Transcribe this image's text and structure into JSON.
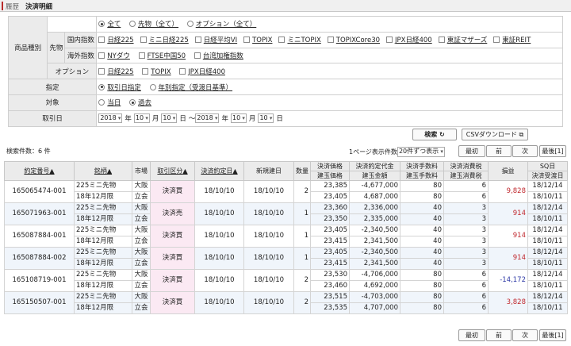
{
  "header": {
    "breadcrumb": "履歴",
    "title": "決済明細"
  },
  "conditions": {
    "product_label": "商品種別",
    "futures_label": "先物",
    "domestic_label": "国内指数",
    "overseas_label": "海外指数",
    "option_label": "オプション",
    "designation_label": "指定",
    "target_label": "対象",
    "date_label": "取引日",
    "product_options": [
      "全て",
      "先物（全て）",
      "オプション（全て）"
    ],
    "domestic_items": [
      "日経225",
      "ミニ日経225",
      "日経平均VI",
      "TOPIX",
      "ミニTOPIX",
      "TOPIXCore30",
      "JPX日経400",
      "東証マザーズ",
      "東証REIT"
    ],
    "overseas_items": [
      "NYダウ",
      "FTSE中国50",
      "台湾加権指数"
    ],
    "option_items": [
      "日経225",
      "TOPIX",
      "JPX日経400"
    ],
    "designation_options": [
      "取引日指定",
      "年別指定（受渡日基準）"
    ],
    "target_options": [
      "当日",
      "過去"
    ],
    "date_from": {
      "year": "2018",
      "month": "10",
      "day": "10"
    },
    "date_to": {
      "year": "2018",
      "month": "10",
      "day": "10"
    },
    "unit_year": "年",
    "unit_month": "月",
    "unit_day": "日",
    "range_sep": "～"
  },
  "buttons": {
    "search": "検索",
    "search_icon": "↻",
    "csv": "CSVダウンロード",
    "csv_icon": "⧉"
  },
  "result_count": "検索件数：6 件",
  "per_page_label": "1ページ表示件数",
  "per_page_value": "20件ずつ表示",
  "pagination": {
    "first": "最初",
    "prev": "前",
    "next": "次",
    "last": "最後[1]"
  },
  "table": {
    "headers": {
      "order_no": "約定番号",
      "order_no_sort": "▲",
      "issue": "銘柄",
      "issue_sort": "▲",
      "market": "市場",
      "kind": "取引区分",
      "kind_sort": "▲",
      "exec_date": "決済約定日",
      "exec_date_sort": "▲",
      "new_date": "新規建日",
      "qty": "数量",
      "settle_price": "決済価格",
      "open_price": "建玉価格",
      "settle_amount": "決済約定代金",
      "open_amount": "建玉金額",
      "settle_fee": "決済手数料",
      "open_fee": "建玉手数料",
      "settle_tax": "決済消費税",
      "open_tax": "建玉消費税",
      "pnl": "損益",
      "sq": "SQ日",
      "delivery": "決済受渡日"
    },
    "rows": [
      {
        "no": "165065474-001",
        "issue1": "225ミニ先物",
        "issue2": "18年12月限",
        "market1": "大阪",
        "market2": "立会",
        "kind": "決済買",
        "exec": "18/10/10",
        "new": "18/10/10",
        "qty": "2",
        "p1": "23,385",
        "p2": "23,405",
        "a1": "-4,677,000",
        "a2": "4,687,000",
        "f1": "80",
        "f2": "80",
        "t1": "6",
        "t2": "6",
        "pnl": "9,828",
        "sq": "18/12/14",
        "del": "18/10/11",
        "color": "red"
      },
      {
        "no": "165071963-001",
        "issue1": "225ミニ先物",
        "issue2": "18年12月限",
        "market1": "大阪",
        "market2": "立会",
        "kind": "決済売",
        "exec": "18/10/10",
        "new": "18/10/10",
        "qty": "1",
        "p1": "23,360",
        "p2": "23,350",
        "a1": "2,336,000",
        "a2": "2,335,000",
        "f1": "40",
        "f2": "40",
        "t1": "3",
        "t2": "3",
        "pnl": "914",
        "sq": "18/12/14",
        "del": "18/10/11",
        "color": "red"
      },
      {
        "no": "165087884-001",
        "issue1": "225ミニ先物",
        "issue2": "18年12月限",
        "market1": "大阪",
        "market2": "立会",
        "kind": "決済買",
        "exec": "18/10/10",
        "new": "18/10/10",
        "qty": "1",
        "p1": "23,405",
        "p2": "23,415",
        "a1": "-2,340,500",
        "a2": "2,341,500",
        "f1": "40",
        "f2": "40",
        "t1": "3",
        "t2": "3",
        "pnl": "914",
        "sq": "18/12/14",
        "del": "18/10/11",
        "color": "red"
      },
      {
        "no": "165087884-002",
        "issue1": "225ミニ先物",
        "issue2": "18年12月限",
        "market1": "大阪",
        "market2": "立会",
        "kind": "決済買",
        "exec": "18/10/10",
        "new": "18/10/10",
        "qty": "1",
        "p1": "23,405",
        "p2": "23,415",
        "a1": "-2,340,500",
        "a2": "2,341,500",
        "f1": "40",
        "f2": "40",
        "t1": "3",
        "t2": "3",
        "pnl": "914",
        "sq": "18/12/14",
        "del": "18/10/11",
        "color": "red"
      },
      {
        "no": "165108719-001",
        "issue1": "225ミニ先物",
        "issue2": "18年12月限",
        "market1": "大阪",
        "market2": "立会",
        "kind": "決済買",
        "exec": "18/10/10",
        "new": "18/10/10",
        "qty": "2",
        "p1": "23,530",
        "p2": "23,460",
        "a1": "-4,706,000",
        "a2": "4,692,000",
        "f1": "80",
        "f2": "80",
        "t1": "6",
        "t2": "6",
        "pnl": "-14,172",
        "sq": "18/12/14",
        "del": "18/10/11",
        "color": "blue"
      },
      {
        "no": "165150507-001",
        "issue1": "225ミニ先物",
        "issue2": "18年12月限",
        "market1": "大阪",
        "market2": "立会",
        "kind": "決済買",
        "exec": "18/10/10",
        "new": "18/10/10",
        "qty": "2",
        "p1": "23,515",
        "p2": "23,535",
        "a1": "-4,703,000",
        "a2": "4,707,000",
        "f1": "80",
        "f2": "80",
        "t1": "6",
        "t2": "6",
        "pnl": "3,828",
        "sq": "18/12/14",
        "del": "18/10/11",
        "color": "red"
      }
    ]
  }
}
